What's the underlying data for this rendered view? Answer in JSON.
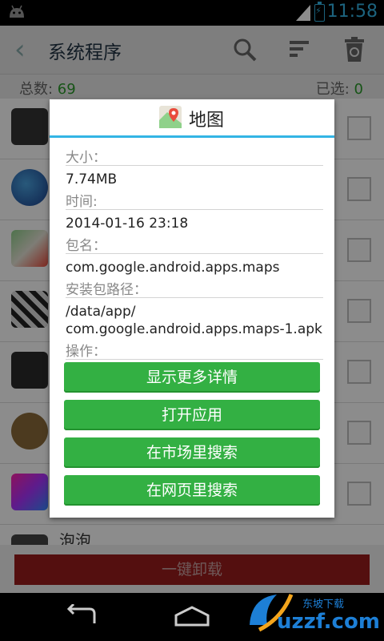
{
  "status": {
    "time": "11:58"
  },
  "header": {
    "title": "系统程序"
  },
  "summary": {
    "total_label": "总数: ",
    "total_value": "69",
    "selected_label": "已选: ",
    "selected_value": "0"
  },
  "list": {
    "partial_item_name": "泡泡"
  },
  "dialog": {
    "title": "地图",
    "size_label": "大小：",
    "size_value": "7.74MB",
    "time_label": "时间:",
    "time_value": "2014-01-16 23:18",
    "package_label": "包名：",
    "package_value": "com.google.android.apps.maps",
    "path_label": "安装包路径：",
    "path_value_line1": "/data/app/",
    "path_value_line2": "com.google.android.apps.maps-1.apk",
    "action_label": "操作：",
    "buttons": [
      "显示更多详情",
      "打开应用",
      "在市场里搜索",
      "在网页里搜索"
    ]
  },
  "bottom": {
    "uninstall_label": "一键卸载"
  },
  "watermark": {
    "text": "uzzf.com",
    "subtext": "东坡下载"
  },
  "colors": {
    "accent": "#33b5e5",
    "button_green": "#33b043",
    "count_green": "#2a9a2a",
    "uninstall_red": "#9a1c1c"
  }
}
